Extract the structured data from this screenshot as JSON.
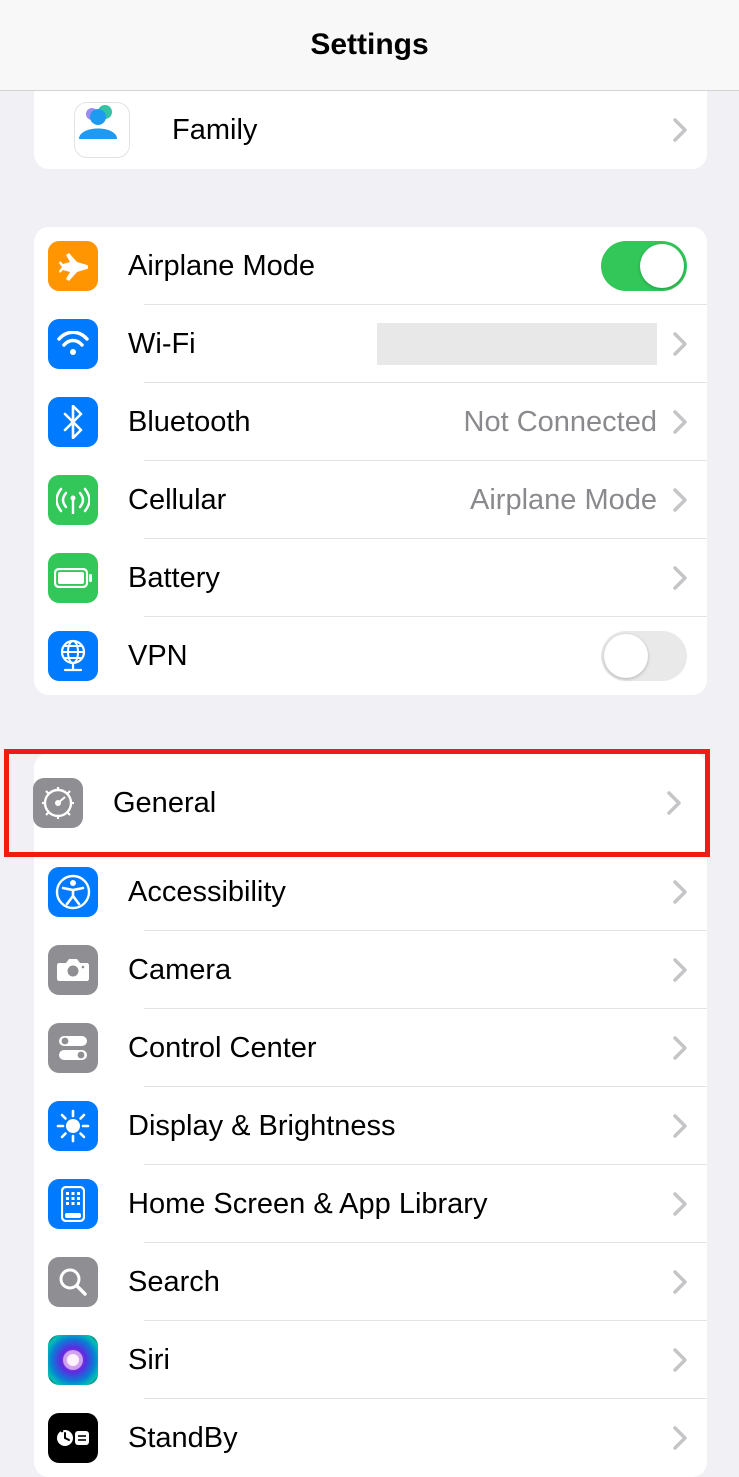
{
  "header": {
    "title": "Settings"
  },
  "group0": {
    "family": {
      "label": "Family"
    }
  },
  "group1": {
    "airplane": {
      "label": "Airplane Mode",
      "on": true
    },
    "wifi": {
      "label": "Wi-Fi"
    },
    "bluetooth": {
      "label": "Bluetooth",
      "detail": "Not Connected"
    },
    "cellular": {
      "label": "Cellular",
      "detail": "Airplane Mode"
    },
    "battery": {
      "label": "Battery"
    },
    "vpn": {
      "label": "VPN",
      "on": false
    }
  },
  "group2": {
    "general": {
      "label": "General"
    },
    "accessibility": {
      "label": "Accessibility"
    },
    "camera": {
      "label": "Camera"
    },
    "controlcenter": {
      "label": "Control Center"
    },
    "display": {
      "label": "Display & Brightness"
    },
    "homescreen": {
      "label": "Home Screen & App Library"
    },
    "search": {
      "label": "Search"
    },
    "siri": {
      "label": "Siri"
    },
    "standby": {
      "label": "StandBy"
    }
  },
  "highlight": "general"
}
